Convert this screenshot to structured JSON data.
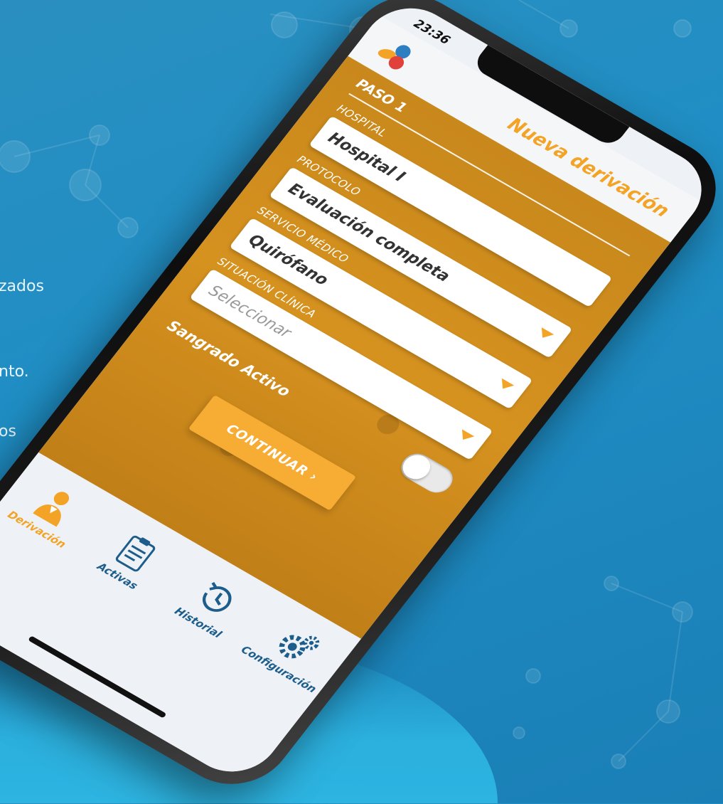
{
  "background_text": {
    "line1": "zados",
    "line2": "nto.",
    "line3": "os"
  },
  "status_bar": {
    "time": "23:36"
  },
  "header": {
    "title": "Nueva derivación",
    "logo_icon": "app-logo-icon"
  },
  "form": {
    "step_title": "PASO 1",
    "hospital": {
      "label": "HOSPITAL",
      "value": "Hospital I"
    },
    "protocolo": {
      "label": "PROTOCOLO",
      "value": "Evaluación completa"
    },
    "servicio": {
      "label": "SERVICIO MÉDICO",
      "value": "Quirófano"
    },
    "situacion": {
      "label": "SITUACIÓN CLÍNICA",
      "placeholder": "Seleccionar"
    },
    "toggle": {
      "label": "Sangrado Activo",
      "on": false
    },
    "continue_label": "CONTINUAR ›"
  },
  "tabs": [
    {
      "label": "Derivación",
      "icon": "doctor-icon",
      "active": true
    },
    {
      "label": "Activas",
      "icon": "clipboard-icon",
      "active": false
    },
    {
      "label": "Historial",
      "icon": "history-icon",
      "active": false
    },
    {
      "label": "Configuración",
      "icon": "gears-icon",
      "active": false
    }
  ],
  "colors": {
    "accent": "#f3a326",
    "primary_blue": "#1d5d8c",
    "background_blue": "#1f8ec4"
  }
}
